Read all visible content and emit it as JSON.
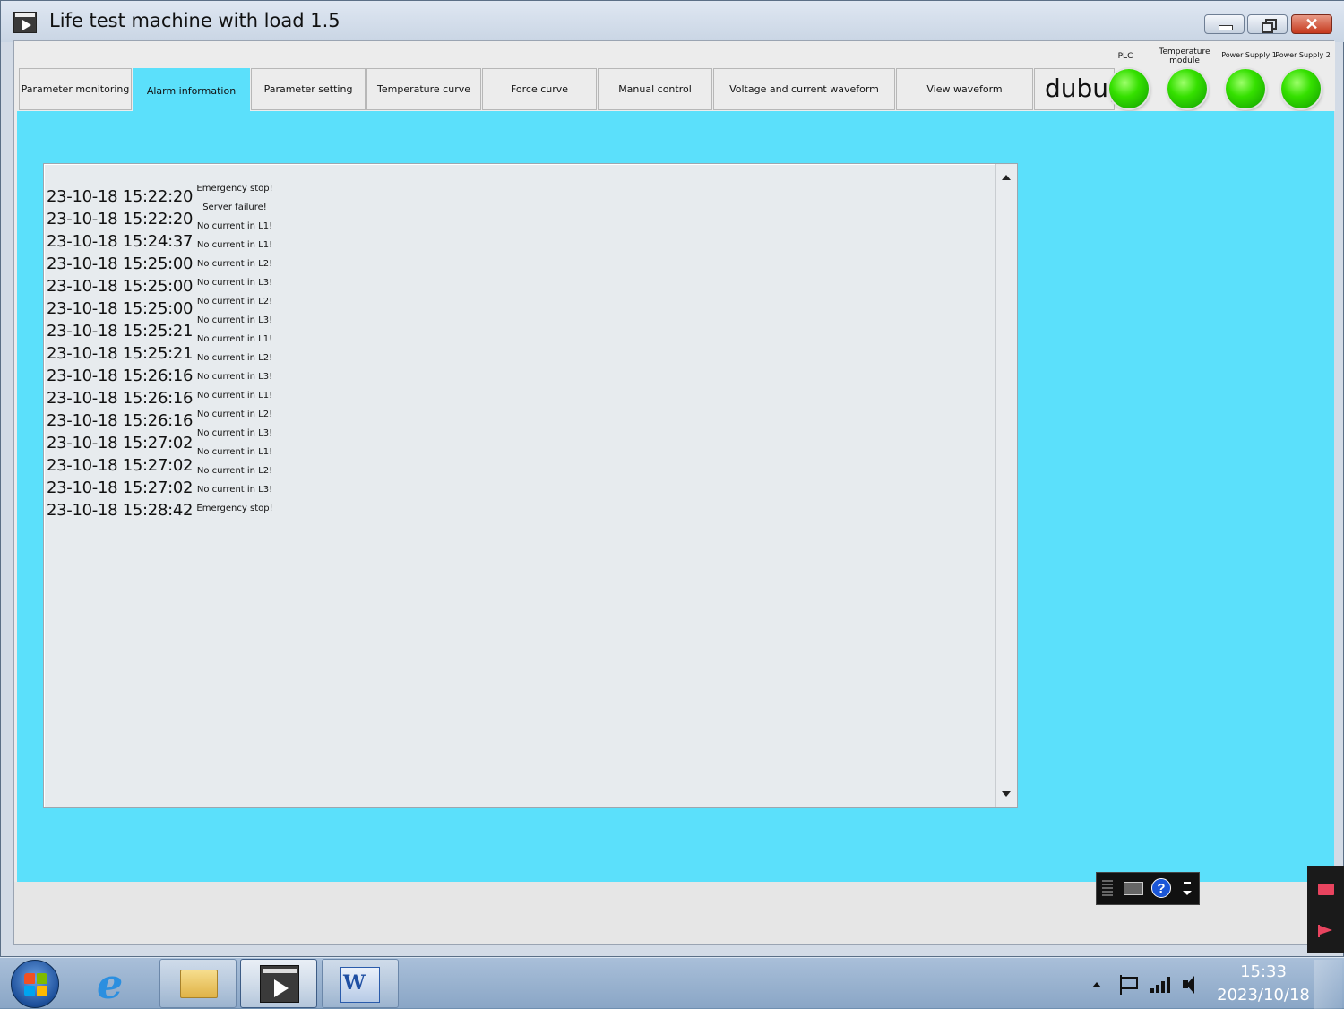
{
  "window": {
    "title": "Life test machine with load 1.5",
    "icon": "media-play-icon",
    "controls": [
      "minimize-icon",
      "restore-icon",
      "close-icon"
    ],
    "close_glyph": "✕"
  },
  "tabs": [
    {
      "label": "Parameter monitoring",
      "active": false
    },
    {
      "label": "Alarm information",
      "active": true
    },
    {
      "label": "Parameter setting",
      "active": false
    },
    {
      "label": "Temperature curve",
      "active": false
    },
    {
      "label": "Force curve",
      "active": false
    },
    {
      "label": "Manual control",
      "active": false
    },
    {
      "label": "Voltage and current waveform",
      "active": false
    },
    {
      "label": "View waveform",
      "active": false
    }
  ],
  "debug_label": "dubug",
  "indicators": [
    {
      "label": "PLC",
      "status": "ok",
      "color": "#35e000"
    },
    {
      "label": "Temperature module",
      "status": "ok",
      "color": "#35e000"
    },
    {
      "label": "Power Supply 1",
      "status": "ok",
      "color": "#35e000"
    },
    {
      "label": "Power Supply 2",
      "status": "ok",
      "color": "#35e000"
    }
  ],
  "alarms": [
    {
      "time": "23-10-18 15:22:20",
      "message": "Emergency stop!"
    },
    {
      "time": "23-10-18 15:22:20",
      "message": "Server failure!"
    },
    {
      "time": "23-10-18 15:24:37",
      "message": "No current in L1!"
    },
    {
      "time": "23-10-18 15:25:00",
      "message": "No current in L1!"
    },
    {
      "time": "23-10-18 15:25:00",
      "message": "No current in L2!"
    },
    {
      "time": "23-10-18 15:25:00",
      "message": "No current in L3!"
    },
    {
      "time": "23-10-18 15:25:21",
      "message": "No current in L2!"
    },
    {
      "time": "23-10-18 15:25:21",
      "message": "No current in L3!"
    },
    {
      "time": "23-10-18 15:26:16",
      "message": "No current in L1!"
    },
    {
      "time": "23-10-18 15:26:16",
      "message": "No current in L2!"
    },
    {
      "time": "23-10-18 15:26:16",
      "message": "No current in L3!"
    },
    {
      "time": "23-10-18 15:27:02",
      "message": "No current in L1!"
    },
    {
      "time": "23-10-18 15:27:02",
      "message": "No current in L2!"
    },
    {
      "time": "23-10-18 15:27:02",
      "message": "No current in L3!"
    },
    {
      "time": "23-10-18 15:28:42",
      "message": "No current in L1!"
    },
    {
      "time": "",
      "message": "No current in L2!"
    },
    {
      "time": "",
      "message": "No current in L3!"
    },
    {
      "time": "",
      "message": "Emergency stop!"
    }
  ],
  "colors": {
    "content_bg": "#5be0fb",
    "active_tab": "#5be0fb",
    "status_ok": "#35e000"
  },
  "ime_toolbar": {
    "help": "?"
  },
  "taskbar": {
    "apps": [
      "start-orb-icon",
      "internet-explorer-icon",
      "file-explorer-icon",
      "life-test-app-icon",
      "word-icon"
    ],
    "ie_glyph": "e",
    "word_glyph": "W",
    "clock_time": "15:33",
    "clock_date": "2023/10/18"
  }
}
